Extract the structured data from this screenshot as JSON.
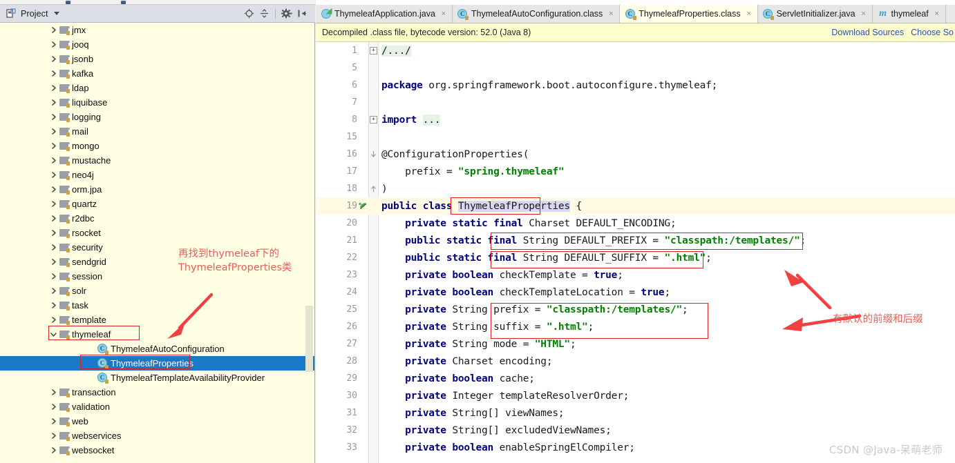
{
  "window": {
    "project_panel": {
      "title": "Project",
      "icon": "project-panel-icon",
      "tools": [
        {
          "name": "locate-file-icon",
          "tooltip": "Select Opened File"
        },
        {
          "name": "collapse-all-icon",
          "tooltip": "Collapse All"
        },
        {
          "name": "settings-gear-icon",
          "tooltip": "Settings"
        },
        {
          "name": "hide-panel-icon",
          "tooltip": "Hide"
        }
      ]
    }
  },
  "tree": {
    "items": [
      {
        "label": "jmx",
        "type": "package",
        "indent": 1,
        "expanded": false,
        "selected": false
      },
      {
        "label": "jooq",
        "type": "package",
        "indent": 1,
        "expanded": false,
        "selected": false
      },
      {
        "label": "jsonb",
        "type": "package",
        "indent": 1,
        "expanded": false,
        "selected": false
      },
      {
        "label": "kafka",
        "type": "package",
        "indent": 1,
        "expanded": false,
        "selected": false
      },
      {
        "label": "ldap",
        "type": "package",
        "indent": 1,
        "expanded": false,
        "selected": false
      },
      {
        "label": "liquibase",
        "type": "package",
        "indent": 1,
        "expanded": false,
        "selected": false
      },
      {
        "label": "logging",
        "type": "package",
        "indent": 1,
        "expanded": false,
        "selected": false
      },
      {
        "label": "mail",
        "type": "package",
        "indent": 1,
        "expanded": false,
        "selected": false
      },
      {
        "label": "mongo",
        "type": "package",
        "indent": 1,
        "expanded": false,
        "selected": false
      },
      {
        "label": "mustache",
        "type": "package",
        "indent": 1,
        "expanded": false,
        "selected": false
      },
      {
        "label": "neo4j",
        "type": "package",
        "indent": 1,
        "expanded": false,
        "selected": false
      },
      {
        "label": "orm.jpa",
        "type": "package",
        "indent": 1,
        "expanded": false,
        "selected": false
      },
      {
        "label": "quartz",
        "type": "package",
        "indent": 1,
        "expanded": false,
        "selected": false
      },
      {
        "label": "r2dbc",
        "type": "package",
        "indent": 1,
        "expanded": false,
        "selected": false
      },
      {
        "label": "rsocket",
        "type": "package",
        "indent": 1,
        "expanded": false,
        "selected": false
      },
      {
        "label": "security",
        "type": "package",
        "indent": 1,
        "expanded": false,
        "selected": false
      },
      {
        "label": "sendgrid",
        "type": "package",
        "indent": 1,
        "expanded": false,
        "selected": false
      },
      {
        "label": "session",
        "type": "package",
        "indent": 1,
        "expanded": false,
        "selected": false
      },
      {
        "label": "solr",
        "type": "package",
        "indent": 1,
        "expanded": false,
        "selected": false
      },
      {
        "label": "task",
        "type": "package",
        "indent": 1,
        "expanded": false,
        "selected": false
      },
      {
        "label": "template",
        "type": "package",
        "indent": 1,
        "expanded": false,
        "selected": false
      },
      {
        "label": "thymeleaf",
        "type": "package",
        "indent": 1,
        "expanded": true,
        "selected": false
      },
      {
        "label": "ThymeleafAutoConfiguration",
        "type": "class",
        "indent": 2,
        "expanded": null,
        "selected": false
      },
      {
        "label": "ThymeleafProperties",
        "type": "class",
        "indent": 2,
        "expanded": null,
        "selected": true
      },
      {
        "label": "ThymeleafTemplateAvailabilityProvider",
        "type": "class",
        "indent": 2,
        "expanded": null,
        "selected": false
      },
      {
        "label": "transaction",
        "type": "package",
        "indent": 1,
        "expanded": false,
        "selected": false
      },
      {
        "label": "validation",
        "type": "package",
        "indent": 1,
        "expanded": false,
        "selected": false
      },
      {
        "label": "web",
        "type": "package",
        "indent": 1,
        "expanded": false,
        "selected": false
      },
      {
        "label": "webservices",
        "type": "package",
        "indent": 1,
        "expanded": false,
        "selected": false
      },
      {
        "label": "websocket",
        "type": "package",
        "indent": 1,
        "expanded": false,
        "selected": false
      }
    ]
  },
  "tabs": [
    {
      "label": "ThymeleafApplication.java",
      "icon": "spring-boot-class-icon",
      "active": false,
      "closable": true
    },
    {
      "label": "ThymeleafAutoConfiguration.class",
      "icon": "class-file-icon",
      "active": false,
      "closable": true
    },
    {
      "label": "ThymeleafProperties.class",
      "icon": "class-file-icon",
      "active": true,
      "closable": true
    },
    {
      "label": "ServletInitializer.java",
      "icon": "java-class-icon",
      "active": false,
      "closable": true
    },
    {
      "label": "thymeleaf",
      "icon": "maven-module-icon",
      "active": false,
      "closable": true
    }
  ],
  "notification": {
    "message": "Decompiled .class file, bytecode version: 52.0 (Java 8)",
    "links": [
      "Download Sources",
      "Choose So"
    ]
  },
  "code": {
    "lines": [
      {
        "num": "1",
        "fold": "plus",
        "tokens": [
          {
            "t": "/.../",
            "c": "plain",
            "bg": "green"
          }
        ]
      },
      {
        "num": "5",
        "fold": "",
        "tokens": []
      },
      {
        "num": "6",
        "fold": "",
        "tokens": [
          {
            "t": "package ",
            "c": "kw"
          },
          {
            "t": "org.springframework.boot.autoconfigure.thymeleaf;",
            "c": "plain"
          }
        ]
      },
      {
        "num": "7",
        "fold": "",
        "tokens": []
      },
      {
        "num": "8",
        "fold": "plus",
        "tokens": [
          {
            "t": "import ",
            "c": "kw"
          },
          {
            "t": "...",
            "c": "plain",
            "bg": "green"
          }
        ]
      },
      {
        "num": "15",
        "fold": "",
        "tokens": []
      },
      {
        "num": "16",
        "fold": "top",
        "tokens": [
          {
            "t": "@ConfigurationProperties(",
            "c": "ann"
          }
        ]
      },
      {
        "num": "17",
        "fold": "",
        "tokens": [
          {
            "t": "    prefix = ",
            "c": "plain"
          },
          {
            "t": "\"spring.thymeleaf\"",
            "c": "str"
          }
        ]
      },
      {
        "num": "18",
        "fold": "bot",
        "tokens": [
          {
            "t": ")",
            "c": "plain"
          }
        ]
      },
      {
        "num": "19",
        "fold": "",
        "gutterIcon": "spring-bean-icon",
        "highlight": true,
        "tokens": [
          {
            "t": "public class ",
            "c": "kw"
          },
          {
            "t": "ThymeleafProperties",
            "c": "plain",
            "bg": "sel"
          },
          {
            "t": " {",
            "c": "plain"
          }
        ]
      },
      {
        "num": "20",
        "fold": "",
        "tokens": [
          {
            "t": "    private static final ",
            "c": "kw"
          },
          {
            "t": "Charset DEFAULT_ENCODING;",
            "c": "plain"
          }
        ]
      },
      {
        "num": "21",
        "fold": "",
        "tokens": [
          {
            "t": "    public static final ",
            "c": "kw"
          },
          {
            "t": "String ",
            "c": "plain"
          },
          {
            "t": "DEFAULT_PREFIX = ",
            "c": "plain"
          },
          {
            "t": "\"classpath:/templates/\"",
            "c": "str"
          },
          {
            "t": ";",
            "c": "plain"
          }
        ]
      },
      {
        "num": "22",
        "fold": "",
        "tokens": [
          {
            "t": "    public static final ",
            "c": "kw"
          },
          {
            "t": "String ",
            "c": "plain"
          },
          {
            "t": "DEFAULT_SUFFIX = ",
            "c": "plain"
          },
          {
            "t": "\".html\"",
            "c": "str"
          },
          {
            "t": ";",
            "c": "plain"
          }
        ]
      },
      {
        "num": "23",
        "fold": "",
        "tokens": [
          {
            "t": "    private boolean ",
            "c": "kw"
          },
          {
            "t": "checkTemplate = ",
            "c": "plain"
          },
          {
            "t": "true",
            "c": "kw"
          },
          {
            "t": ";",
            "c": "plain"
          }
        ]
      },
      {
        "num": "24",
        "fold": "",
        "tokens": [
          {
            "t": "    private boolean ",
            "c": "kw"
          },
          {
            "t": "checkTemplateLocation = ",
            "c": "plain"
          },
          {
            "t": "true",
            "c": "kw"
          },
          {
            "t": ";",
            "c": "plain"
          }
        ]
      },
      {
        "num": "25",
        "fold": "",
        "tokens": [
          {
            "t": "    private ",
            "c": "kw"
          },
          {
            "t": "String ",
            "c": "plain"
          },
          {
            "t": "prefix = ",
            "c": "plain"
          },
          {
            "t": "\"classpath:/templates/\"",
            "c": "str"
          },
          {
            "t": ";",
            "c": "plain"
          }
        ]
      },
      {
        "num": "26",
        "fold": "",
        "tokens": [
          {
            "t": "    private ",
            "c": "kw"
          },
          {
            "t": "String ",
            "c": "plain"
          },
          {
            "t": "suffix = ",
            "c": "plain"
          },
          {
            "t": "\".html\"",
            "c": "str"
          },
          {
            "t": ";",
            "c": "plain"
          }
        ]
      },
      {
        "num": "27",
        "fold": "",
        "tokens": [
          {
            "t": "    private ",
            "c": "kw"
          },
          {
            "t": "String mode = ",
            "c": "plain"
          },
          {
            "t": "\"HTML\"",
            "c": "str"
          },
          {
            "t": ";",
            "c": "plain"
          }
        ]
      },
      {
        "num": "28",
        "fold": "",
        "tokens": [
          {
            "t": "    private ",
            "c": "kw"
          },
          {
            "t": "Charset encoding;",
            "c": "plain"
          }
        ]
      },
      {
        "num": "29",
        "fold": "",
        "tokens": [
          {
            "t": "    private boolean ",
            "c": "kw"
          },
          {
            "t": "cache;",
            "c": "plain"
          }
        ]
      },
      {
        "num": "30",
        "fold": "",
        "tokens": [
          {
            "t": "    private ",
            "c": "kw"
          },
          {
            "t": "Integer templateResolverOrder;",
            "c": "plain"
          }
        ]
      },
      {
        "num": "31",
        "fold": "",
        "tokens": [
          {
            "t": "    private ",
            "c": "kw"
          },
          {
            "t": "String[] viewNames;",
            "c": "plain"
          }
        ]
      },
      {
        "num": "32",
        "fold": "",
        "tokens": [
          {
            "t": "    private ",
            "c": "kw"
          },
          {
            "t": "String[] excludedViewNames;",
            "c": "plain"
          }
        ]
      },
      {
        "num": "33",
        "fold": "",
        "tokens": [
          {
            "t": "    private boolean ",
            "c": "kw"
          },
          {
            "t": "enableSpringElCompiler;",
            "c": "plain"
          }
        ]
      }
    ]
  },
  "annotations": {
    "tree_note": "再找到thymeleaf下的\nThymeleafProperties类",
    "code_note": "有默认的前缀和后缀"
  },
  "watermark": "CSDN @Java-呆萌老师",
  "colors": {
    "selection": "#1978c8",
    "annotation_red": "#f05a5a",
    "box_red": "#e02020",
    "tree_bg": "#ffffe4",
    "notify_bg": "#ffffcc",
    "keyword": "#000080",
    "string": "#008000",
    "line_highlight": "#fffae3"
  }
}
